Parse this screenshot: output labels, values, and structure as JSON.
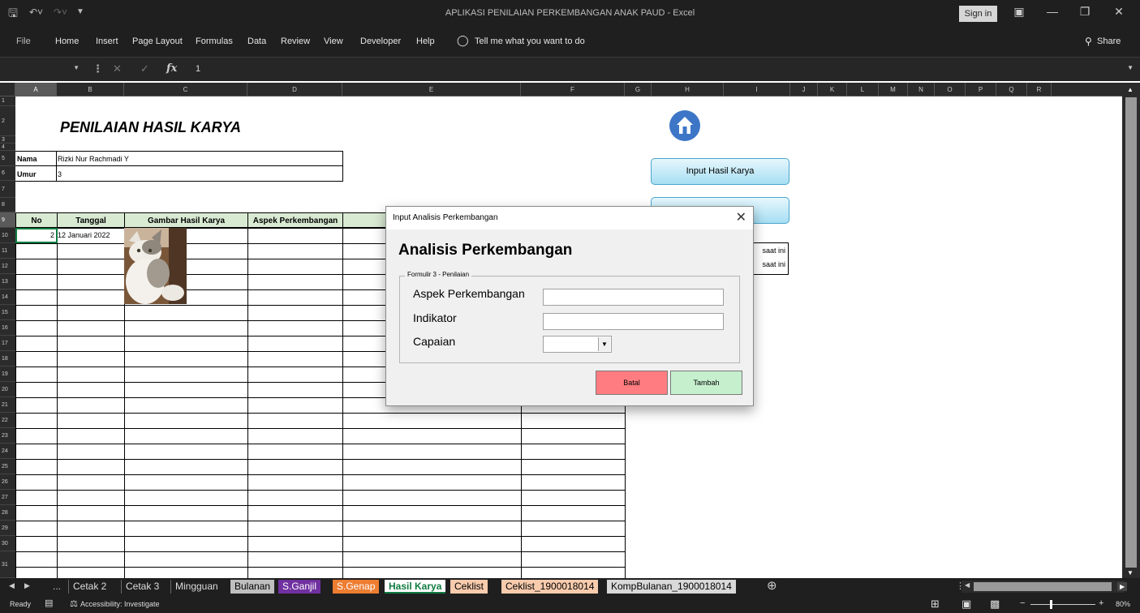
{
  "app": {
    "window_title": "APLIKASI PENILAIAN PERKEMBANGAN ANAK PAUD  -  Excel",
    "sign_in": "Sign in",
    "share": "Share"
  },
  "menu": [
    "File",
    "Home",
    "Insert",
    "Page Layout",
    "Formulas",
    "Data",
    "Review",
    "View",
    "Developer",
    "Help"
  ],
  "tell_me": "Tell me what you want to do",
  "formula_bar": {
    "fx": "fx",
    "value": "1"
  },
  "columns": [
    "A",
    "B",
    "C",
    "D",
    "E",
    "F",
    "G",
    "H",
    "I",
    "J",
    "K",
    "L",
    "M",
    "N",
    "O",
    "P",
    "Q",
    "R"
  ],
  "rows": [
    "1",
    "2",
    "3",
    "4",
    "5",
    "6",
    "7",
    "8",
    "9",
    "10",
    "11",
    "12",
    "13",
    "14",
    "15",
    "16",
    "17",
    "18",
    "19",
    "20",
    "21",
    "22",
    "23",
    "24",
    "25",
    "26",
    "27",
    "28",
    "29",
    "30",
    "31"
  ],
  "sheet": {
    "title": "PENILAIAN HASIL KARYA",
    "nama_label": "Nama",
    "nama_value": "Rizki Nur Rachmadi Y",
    "umur_label": "Umur",
    "umur_value": "3",
    "headers": [
      "No",
      "Tanggal",
      "Gambar Hasil Karya",
      "Aspek Perkembangan"
    ],
    "row1_no": "2",
    "row1_tanggal": "12 Januari 2022",
    "side_text_1": "saat ini",
    "side_text_2": "saat ini"
  },
  "buttons": {
    "input_hasil_karya": "Input Hasil Karya"
  },
  "dialog": {
    "title": "Input Analisis Perkembangan",
    "heading": "Analisis Perkembangan",
    "frame_label": "Formulir 3 - Penilaian",
    "field_aspek": "Aspek Perkembangan",
    "field_indikator": "Indikator",
    "field_capaian": "Capaian",
    "btn_batal": "Batal",
    "btn_tambah": "Tambah",
    "btn_batal_color": "#ff7c80",
    "btn_tambah_color": "#c6efce"
  },
  "tabs": [
    {
      "label": "Cetak 2",
      "bg": "#ffffff"
    },
    {
      "label": "Cetak 3",
      "bg": "#ffffff"
    },
    {
      "label": "Mingguan",
      "bg": "#ffffff"
    },
    {
      "label": "Bulanan",
      "bg": "#bfbfbf"
    },
    {
      "label": "S.Ganjil",
      "bg": "#7030a0"
    },
    {
      "label": "S.Genap",
      "bg": "#ed7d31"
    },
    {
      "label": "Hasil Karya",
      "bg": "#ffffff",
      "active": true
    },
    {
      "label": "Ceklist",
      "bg": "#f8cbad"
    },
    {
      "label": "Ceklist_1900018014",
      "bg": "#f8cbad"
    },
    {
      "label": "KompBulanan_1900018014",
      "bg": "#d9d9d9"
    }
  ],
  "tabs_ellipsis": "...",
  "status": {
    "ready": "Ready",
    "accessibility": "Accessibility: Investigate",
    "zoom": "80%"
  }
}
